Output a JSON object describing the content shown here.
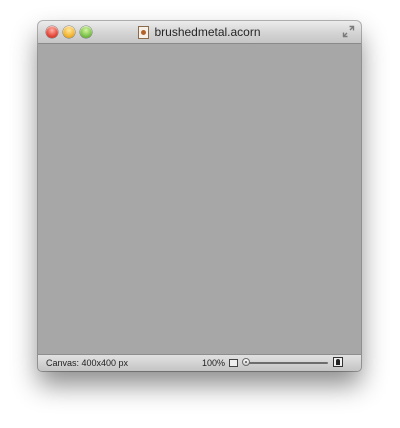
{
  "window": {
    "title": "brushedmetal.acorn",
    "icons": {
      "close": "close-button",
      "minimize": "minimize-button",
      "zoom": "zoom-button",
      "document": "acorn-document-icon",
      "fullscreen": "fullscreen-icon"
    }
  },
  "statusbar": {
    "canvas_size": "Canvas: 400x400 px",
    "zoom_level": "100%",
    "zoom_slider_value": 0
  },
  "colors": {
    "canvas": "#a7a7a7",
    "titlebar": "#d4d4d4"
  }
}
